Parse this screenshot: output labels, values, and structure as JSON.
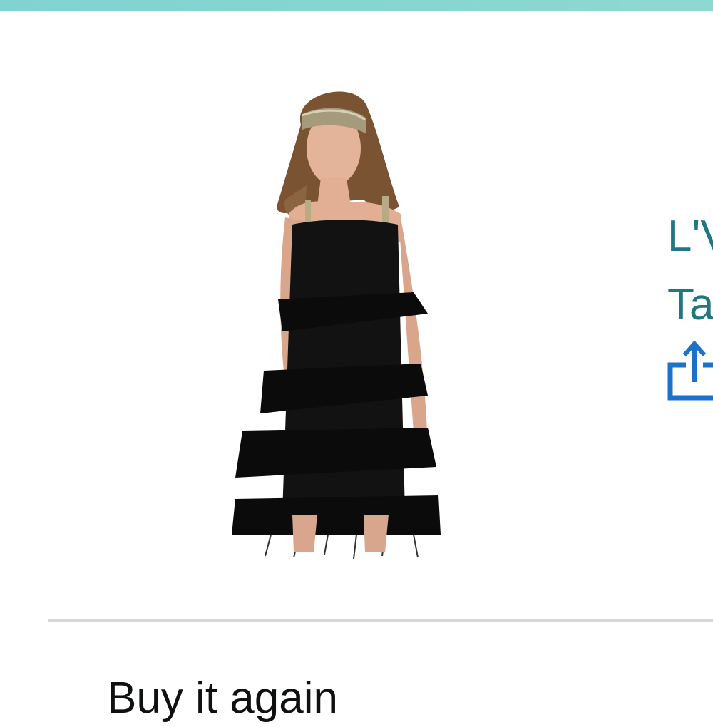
{
  "header": {
    "accent_color": "#86d6d0"
  },
  "product": {
    "image_alt": "Women's black fringe flapper dress with gold headband",
    "title_lines": [
      "L'V",
      "Ta"
    ],
    "title_color": "#217780",
    "share_icon": "share-icon"
  },
  "buy_again": {
    "title": "Buy it again"
  }
}
